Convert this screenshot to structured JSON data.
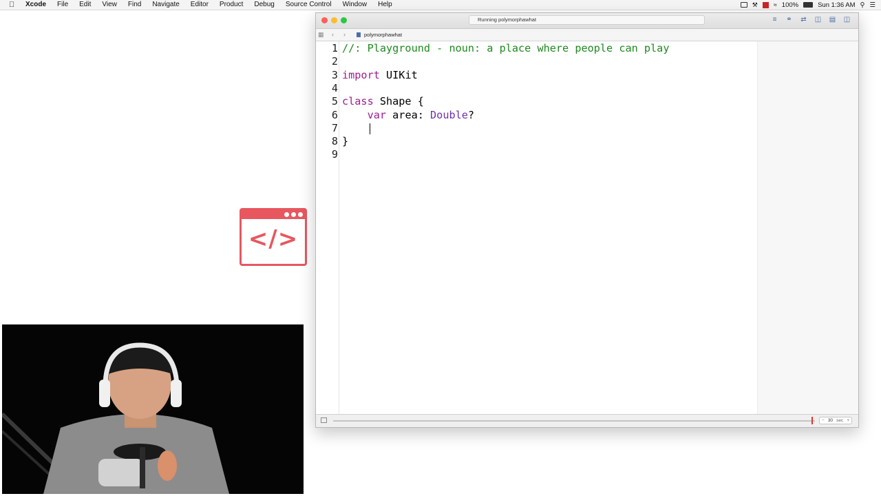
{
  "menubar": {
    "app_name": "Xcode",
    "items": [
      "File",
      "Edit",
      "View",
      "Find",
      "Navigate",
      "Editor",
      "Product",
      "Debug",
      "Source Control",
      "Window",
      "Help"
    ],
    "battery": "100%",
    "clock": "Sun 1:36 AM"
  },
  "code_icon": {
    "glyph": "</>",
    "color": "#e8575f"
  },
  "window": {
    "status": "Running polymorphawhat",
    "file_name": "polymorphawhat",
    "lines": [
      {
        "n": "1",
        "tokens": [
          {
            "t": "//: Playground - noun: a place where people can play",
            "c": "com"
          }
        ]
      },
      {
        "n": "2",
        "tokens": []
      },
      {
        "n": "3",
        "tokens": [
          {
            "t": "import",
            "c": "kw"
          },
          {
            "t": " UIKit",
            "c": ""
          }
        ]
      },
      {
        "n": "4",
        "tokens": []
      },
      {
        "n": "5",
        "tokens": [
          {
            "t": "class",
            "c": "kw"
          },
          {
            "t": " Shape {",
            "c": ""
          }
        ]
      },
      {
        "n": "6",
        "tokens": [
          {
            "t": "    ",
            "c": ""
          },
          {
            "t": "var",
            "c": "kw"
          },
          {
            "t": " area: ",
            "c": ""
          },
          {
            "t": "Double",
            "c": "ty"
          },
          {
            "t": "?",
            "c": ""
          }
        ]
      },
      {
        "n": "7",
        "tokens": []
      },
      {
        "n": "8",
        "tokens": [
          {
            "t": "}",
            "c": ""
          }
        ]
      },
      {
        "n": "9",
        "tokens": []
      }
    ],
    "timer_value": "30",
    "timer_unit": "sec"
  },
  "colors": {
    "comment": "#1e8a1e",
    "keyword": "#9b1e93",
    "type": "#6f2fa8",
    "playhead": "#e0342c"
  }
}
